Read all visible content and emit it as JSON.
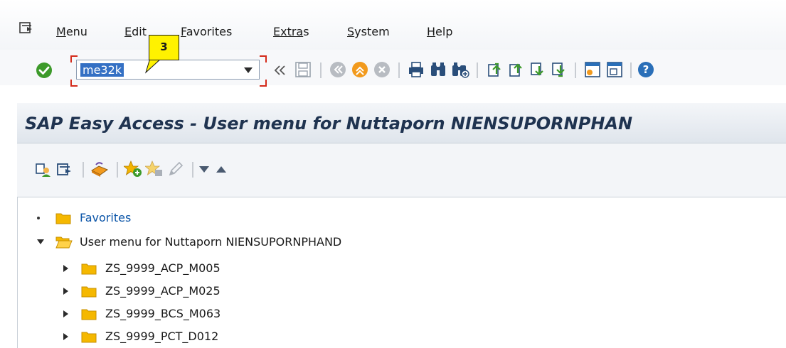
{
  "menubar": {
    "items": [
      {
        "label": "Menu",
        "underline": "M",
        "rest": "enu"
      },
      {
        "label": "Edit",
        "underline": "E",
        "rest": "dit"
      },
      {
        "label": "Favorites",
        "underline": "F",
        "rest": "avorites"
      },
      {
        "label": "Extras",
        "underline": "Extra",
        "rest": "s"
      },
      {
        "label": "System",
        "underline": "S",
        "rest": "ystem"
      },
      {
        "label": "Help",
        "underline": "H",
        "rest": "elp"
      }
    ]
  },
  "toolbar": {
    "command_value": "me32k",
    "step_number": "3",
    "icons": [
      "enter-icon",
      "back-arrows-icon",
      "save-icon",
      "back-icon",
      "exit-icon",
      "cancel-icon",
      "print-icon",
      "find-icon",
      "find-next-icon",
      "first-page-icon",
      "previous-page-icon",
      "next-page-icon",
      "last-page-icon",
      "new-session-icon",
      "shortcut-icon",
      "help-icon"
    ]
  },
  "header": {
    "title": "SAP Easy Access  -  User menu for Nuttaporn NIENSUPORNPHAN"
  },
  "app_toolbar": {
    "icons": [
      "other-menu-icon",
      "create-role-icon",
      "assign-users-icon",
      "add-favorite-icon",
      "delete-favorite-icon",
      "change-favorite-icon",
      "expand-icon",
      "collapse-icon"
    ]
  },
  "tree": {
    "favorites_label": "Favorites",
    "user_menu_label": "User menu for Nuttaporn NIENSUPORNPHAND",
    "items": [
      "ZS_9999_ACP_M005",
      "ZS_9999_ACP_M025",
      "ZS_9999_BCS_M063",
      "ZS_9999_PCT_D012"
    ]
  },
  "colors": {
    "accent": "#3470c4",
    "callout": "#fff200",
    "title": "#1f3350",
    "folder": "#f5b800",
    "highlight_frame": "#d42a1a"
  }
}
